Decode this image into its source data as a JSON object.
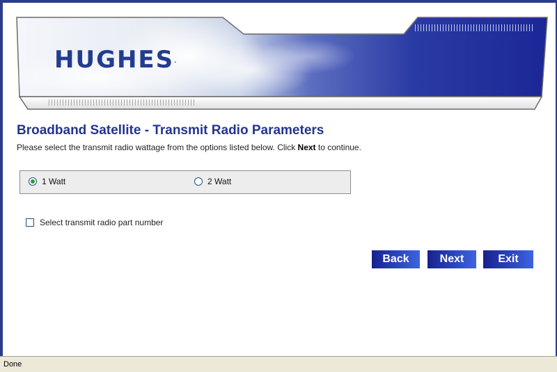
{
  "banner": {
    "logo_text": "HUGHES",
    "logo_mark": "."
  },
  "page": {
    "title": "Broadband Satellite - Transmit Radio Parameters",
    "instructions_before": "Please select the transmit radio wattage from the options listed below. Click ",
    "instructions_bold": "Next",
    "instructions_after": " to continue."
  },
  "wattage_options": {
    "selected": "1 Watt",
    "option_1": "1 Watt",
    "option_2": "2 Watt"
  },
  "part_number_checkbox": {
    "label": "Select transmit radio part number",
    "checked": false
  },
  "buttons": {
    "back": "Back",
    "next": "Next",
    "exit": "Exit"
  },
  "statusbar": {
    "text": "Done"
  },
  "colors": {
    "title": "#23358c",
    "button": "#2a45c2",
    "frame": "#2b3c8c",
    "radio_selected": "#2f9b2f"
  }
}
